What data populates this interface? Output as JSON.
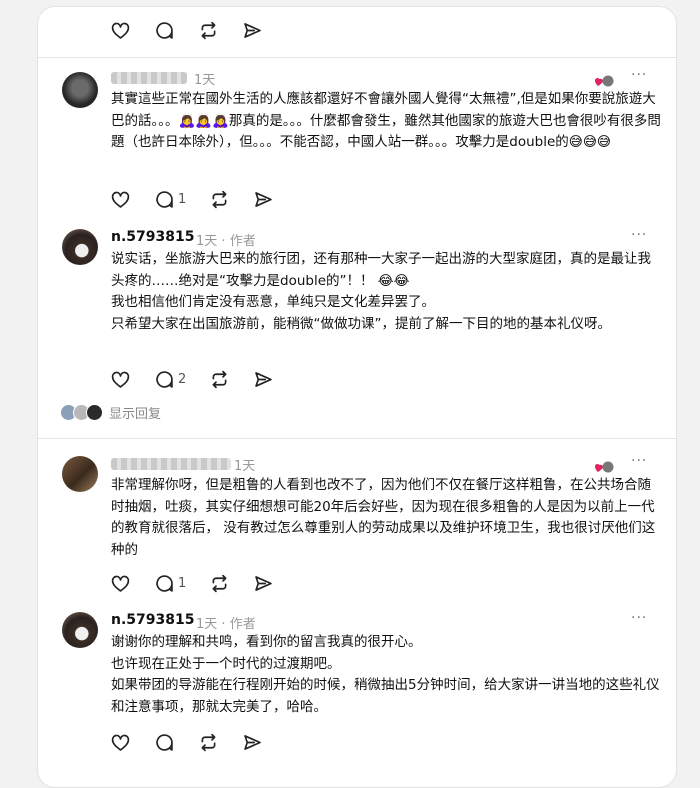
{
  "post1": {
    "time": "1天",
    "text": "其實這些正常在國外生活的人應該都還好不會讓外國人覺得“太無禮”,但是如果你要說旅遊大巴的話。。。🙇‍♀️🙇‍♀️🙇‍♀️那真的是。。。什麼都會發生，雖然其他國家的旅遊大巴也會很吵有很多問題（也許日本除外），但。。。不能否認，中國人站一群。。。攻擊力是double的😅😅😅",
    "reply_count": "1"
  },
  "reply1": {
    "username": "n.5793815",
    "time": "1天",
    "author_tag": "作者",
    "text": "说实话，坐旅游大巴来的旅行团，还有那种一大家子一起出游的大型家庭团，真的是最让我头疼的……绝对是“攻擊力是double的”！！ 😂😂\n我也相信他们肯定没有恶意，单纯只是文化差异罢了。\n只希望大家在出国旅游前，能稍微“做做功课”，提前了解一下目的地的基本礼仪呀。",
    "reply_count": "2"
  },
  "show_replies_label": "显示回复",
  "post2": {
    "time": "1天",
    "text": "非常理解你呀，但是粗鲁的人看到也改不了，因为他们不仅在餐厅这样粗鲁，在公共场合随时抽烟，吐痰，其实仔细想想可能20年后会好些，因为现在很多粗鲁的人是因为以前上一代的教育就很落后， 没有教过怎么尊重别人的劳动成果以及维护环境卫生，我也很讨厌他们这种的",
    "reply_count": "1"
  },
  "reply2": {
    "username": "n.5793815",
    "time": "1天",
    "author_tag": "作者",
    "text": "谢谢你的理解和共鸣，看到你的留言我真的很开心。\n也许现在正处于一个时代的过渡期吧。\n如果带团的导游能在行程刚开始的时候，稍微抽出5分钟时间，给大家讲一讲当地的这些礼仪和注意事项，那就太完美了，哈哈。"
  },
  "more_glyph": "···",
  "sep_dot": "·",
  "icons": [
    "heart-icon",
    "comment-icon",
    "repost-icon",
    "share-icon",
    "more-icon"
  ]
}
